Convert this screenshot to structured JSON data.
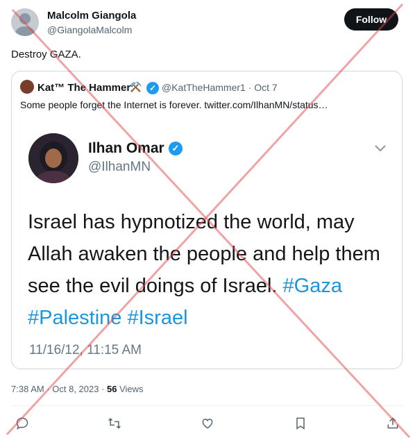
{
  "author": {
    "name": "Malcolm Giangola",
    "handle": "@GiangolaMalcolm"
  },
  "follow_label": "Follow",
  "tweet_text": "Destroy GAZA.",
  "quote": {
    "name": "Kat™ The Hammer",
    "emoji": "⚒️",
    "handle_date": "@KatTheHammer1 · Oct 7",
    "text": "Some people forget the Internet is forever.  twitter.com/IlhanMN/status…"
  },
  "embedded": {
    "name": "Ilhan Omar",
    "handle": "@IlhanMN",
    "body_plain": "Israel has hypnotized the world, may Allah awaken the people and help them see the evil doings of Israel.",
    "hashtags": [
      "#Gaza",
      "#Palestine",
      "#Israel"
    ],
    "timestamp": "11/16/12, 11:15 AM"
  },
  "meta": {
    "time_date": "7:38 AM · Oct 8, 2023 · ",
    "views_count": "56",
    "views_label": " Views"
  },
  "actions": [
    "reply-icon",
    "retweet-icon",
    "like-icon",
    "bookmark-icon",
    "share-icon"
  ],
  "colors": {
    "accent": "#1d9bf0",
    "overlay_x": "#e0474c"
  }
}
